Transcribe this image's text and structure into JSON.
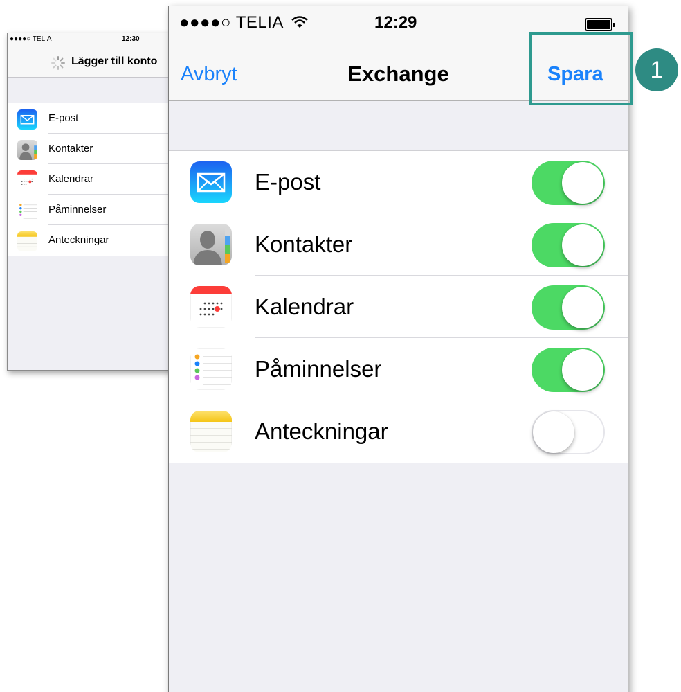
{
  "back_screen": {
    "status": {
      "carrier": "●●●●○ TELIA",
      "time": "12:30"
    },
    "title": "Lägger till konto",
    "items": [
      {
        "label": "E-post",
        "icon": "mail-icon"
      },
      {
        "label": "Kontakter",
        "icon": "contacts-icon"
      },
      {
        "label": "Kalendrar",
        "icon": "calendar-icon"
      },
      {
        "label": "Påminnelser",
        "icon": "reminders-icon"
      },
      {
        "label": "Anteckningar",
        "icon": "notes-icon"
      }
    ]
  },
  "front_screen": {
    "status": {
      "carrier": "●●●●○ TELIA",
      "time": "12:29"
    },
    "nav": {
      "cancel_label": "Avbryt",
      "title": "Exchange",
      "save_label": "Spara"
    },
    "items": [
      {
        "label": "E-post",
        "icon": "mail-icon",
        "enabled": true
      },
      {
        "label": "Kontakter",
        "icon": "contacts-icon",
        "enabled": true
      },
      {
        "label": "Kalendrar",
        "icon": "calendar-icon",
        "enabled": true
      },
      {
        "label": "Påminnelser",
        "icon": "reminders-icon",
        "enabled": true
      },
      {
        "label": "Anteckningar",
        "icon": "notes-icon",
        "enabled": false
      }
    ]
  },
  "callout": {
    "number": "1"
  },
  "colors": {
    "accent": "#1a82fb",
    "toggle_on": "#4cd964",
    "callout": "#2e8b83"
  }
}
